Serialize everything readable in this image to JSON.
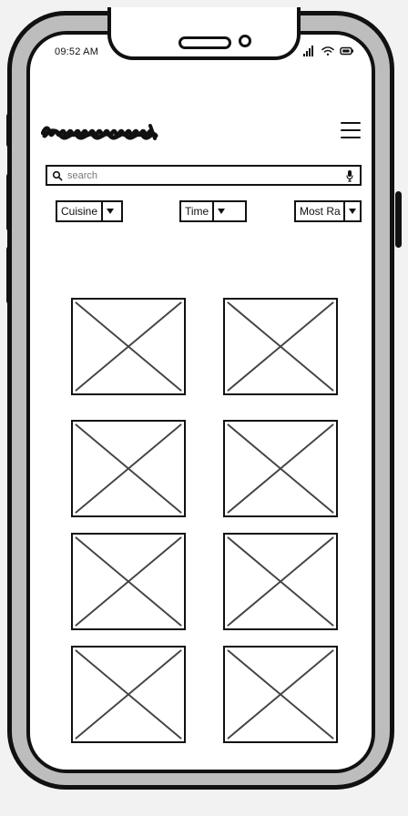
{
  "status": {
    "time": "09:52 AM"
  },
  "search": {
    "placeholder": "search"
  },
  "filters": {
    "cuisine": "Cuisine",
    "time": "Time",
    "rating": "Most Ra"
  },
  "icons": {
    "search": "search-icon",
    "mic": "mic-icon",
    "menu": "menu-icon",
    "dropdown": "triangle-down-icon",
    "signal": "signal-icon",
    "wifi": "wifi-icon",
    "battery": "battery-icon"
  },
  "colors": {
    "outline": "#111111",
    "frame": "#bdbdbd",
    "screen": "#ffffff"
  }
}
